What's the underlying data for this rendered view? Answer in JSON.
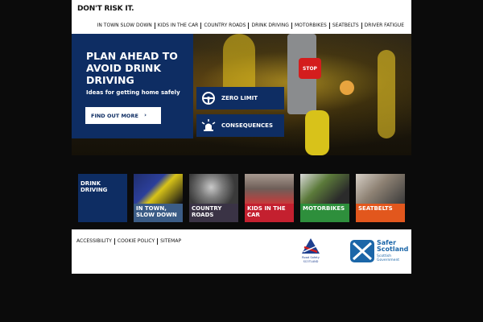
{
  "header": {
    "logo": "DON'T RISK IT.",
    "nav": [
      "IN TOWN SLOW DOWN",
      "KIDS IN THE CAR",
      "COUNTRY ROADS",
      "DRINK DRIVING",
      "MOTORBIKES",
      "SEATBELTS",
      "DRIVER FATIGUE"
    ]
  },
  "hero": {
    "title": "PLAN AHEAD TO AVOID DRINK DRIVING",
    "subtitle": "Ideas for getting home safely",
    "cta_label": "FIND OUT MORE",
    "cta_icon": "chevron-right-icon",
    "stop_label": "STOP",
    "side_buttons": [
      {
        "label": "ZERO LIMIT",
        "icon": "steering-wheel-icon"
      },
      {
        "label": "CONSEQUENCES",
        "icon": "siren-light-icon"
      }
    ]
  },
  "tiles": [
    {
      "label": "DRINK DRIVING",
      "color": "#0e2d63"
    },
    {
      "label": "IN TOWN, SLOW DOWN",
      "color": "#3b5c86"
    },
    {
      "label": "COUNTRY ROADS",
      "color": "#3a3345"
    },
    {
      "label": "KIDS IN THE CAR",
      "color": "#c4202f"
    },
    {
      "label": "MOTORBIKES",
      "color": "#2e8f3c"
    },
    {
      "label": "SEATBELTS",
      "color": "#e2571d"
    }
  ],
  "footer": {
    "links": [
      "ACCESSIBILITY",
      "COOKIE POLICY",
      "SITEMAP"
    ],
    "road_safety_lines": [
      "Road Safety",
      "SCOTLAND"
    ],
    "safer_scotland": "Safer Scotland",
    "gov_lines": [
      "Scottish",
      "Government"
    ]
  },
  "colors": {
    "brand_navy": "#0e2d63",
    "background": "#0b0b0b",
    "stop_red": "#d41d1d",
    "gov_blue": "#1b66a8"
  }
}
